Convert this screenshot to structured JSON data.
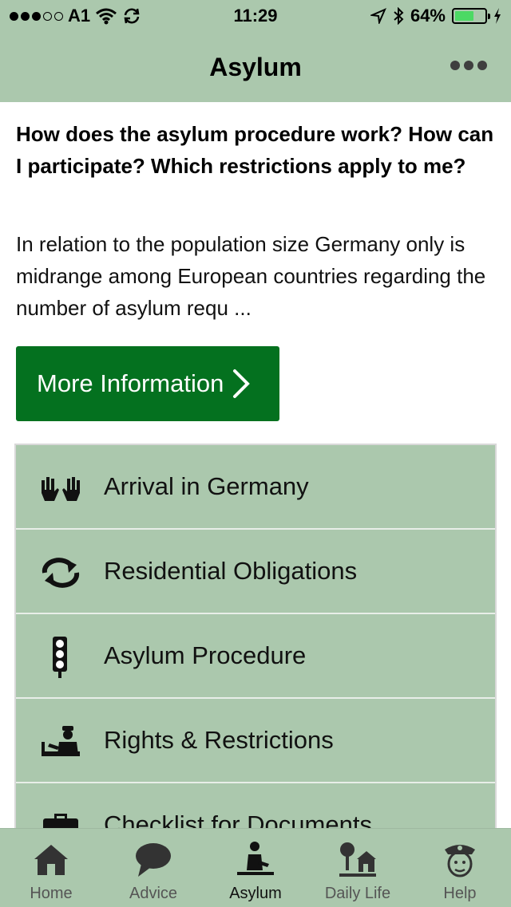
{
  "status_bar": {
    "carrier": "A1",
    "time": "11:29",
    "battery": "64%",
    "battery_level": 0.64,
    "signal_dots_filled": 3,
    "signal_dots_total": 5
  },
  "nav": {
    "title": "Asylum",
    "more_icon": "ellipsis-icon"
  },
  "intro": {
    "question": "How does the asylum procedure work? How can I participate? Which restrictions apply to me?",
    "summary": "In relation to the population size Germany only is midrange among European countries regarding the number of asylum requ ..."
  },
  "more_info_button": {
    "label": "More Information",
    "icon": "chevron-right-icon",
    "color": "#04711f"
  },
  "menu": {
    "items": [
      {
        "label": "Arrival in Germany",
        "icon": "raised-hands-icon"
      },
      {
        "label": "Residential Obligations",
        "icon": "repeat-arrows-icon"
      },
      {
        "label": "Asylum Procedure",
        "icon": "traffic-light-icon"
      },
      {
        "label": "Rights & Restrictions",
        "icon": "officer-desk-icon"
      },
      {
        "label": "Checklist for Documents",
        "icon": "briefcase-icon"
      }
    ]
  },
  "tabbar": {
    "tabs": [
      {
        "label": "Home",
        "icon": "house-icon"
      },
      {
        "label": "Advice",
        "icon": "speech-bubble-icon"
      },
      {
        "label": "Asylum",
        "icon": "person-desk-icon",
        "active": true
      },
      {
        "label": "Daily Life",
        "icon": "trees-house-icon"
      },
      {
        "label": "Help",
        "icon": "police-officer-icon"
      }
    ]
  },
  "colors": {
    "header_bg": "#abc8ad",
    "button_green": "#04711f",
    "battery_green": "#4cd964"
  }
}
